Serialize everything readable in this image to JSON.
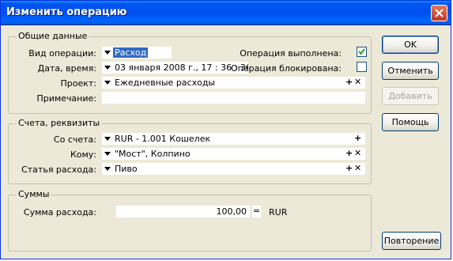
{
  "window": {
    "title": "Изменить операцию"
  },
  "general": {
    "title": "Общие данные",
    "op_type_label": "Вид операции:",
    "op_type_value": "Расход",
    "datetime_label": "Дата, время:",
    "datetime_value": "03 января 2008 г.,  17 : 36 : 36",
    "done_label": "Операция выполнена:",
    "done_checked": true,
    "blocked_label": "Операция блокирована:",
    "blocked_checked": false,
    "project_label": "Проект:",
    "project_value": "Ежедневные расходы",
    "note_label": "Примечание:",
    "note_value": ""
  },
  "accounts": {
    "title": "Счета, реквизиты",
    "from_label": "Со счета:",
    "from_value": "RUR - 1.001 Кошелек",
    "to_label": "Кому:",
    "to_value": "\"Мост\", Колпино",
    "expense_label": "Статья расхода:",
    "expense_value": "Пиво"
  },
  "sums": {
    "title": "Суммы",
    "expense_sum_label": "Сумма расхода:",
    "expense_sum_value": "100,00",
    "eq_label": "=",
    "currency": "RUR"
  },
  "buttons": {
    "ok": "OK",
    "cancel": "Отменить",
    "add": "Добавить",
    "help": "Помощь",
    "repeat": "Повторение"
  },
  "glyphs": {
    "plus": "+",
    "cross": "✕"
  }
}
